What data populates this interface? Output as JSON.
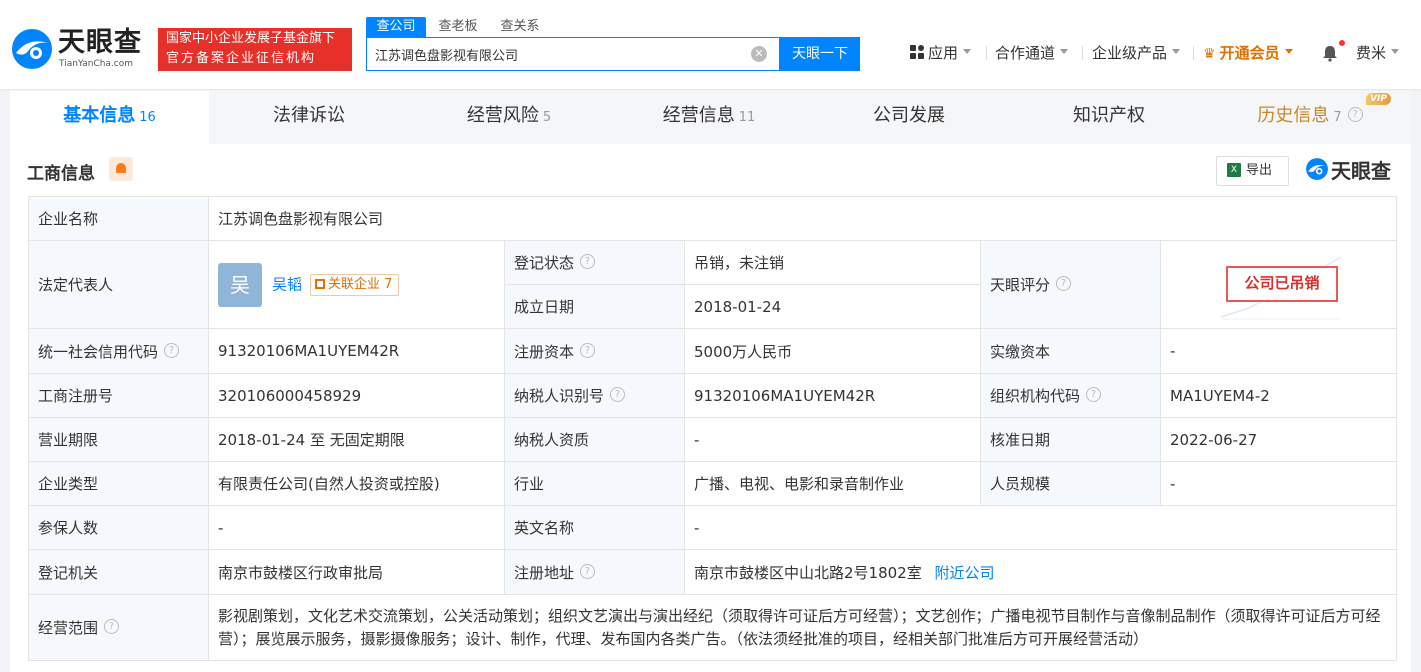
{
  "header": {
    "logo_text": "天眼查",
    "logo_sub": "TianYanCha.com",
    "badge_line1": "国家中小企业发展子基金旗下",
    "badge_line2": "官方备案企业征信机构",
    "search_tabs": [
      "查公司",
      "查老板",
      "查关系"
    ],
    "search_value": "江苏调色盘影视有限公司",
    "search_button": "天眼一下",
    "nav": {
      "apps": "应用",
      "channel": "合作通道",
      "enterprise": "企业级产品",
      "vip": "开通会员",
      "user": "费米"
    }
  },
  "tabs": [
    {
      "label": "基本信息",
      "count": "16"
    },
    {
      "label": "法律诉讼",
      "count": ""
    },
    {
      "label": "经营风险",
      "count": "5"
    },
    {
      "label": "经营信息",
      "count": "11"
    },
    {
      "label": "公司发展",
      "count": ""
    },
    {
      "label": "知识产权",
      "count": ""
    },
    {
      "label": "历史信息",
      "count": "7"
    }
  ],
  "vip_tag": "VIP",
  "section": {
    "title": "工商信息",
    "export_label": "导出",
    "watermark": "天眼查"
  },
  "info": {
    "company_name_label": "企业名称",
    "company_name": "江苏调色盘影视有限公司",
    "legal_rep_label": "法定代表人",
    "legal_rep_avatar": "吴",
    "legal_rep_name": "吴韬",
    "related_label": "关联企业",
    "related_count": "7",
    "reg_status_label": "登记状态",
    "reg_status": "吊销，未注销",
    "found_date_label": "成立日期",
    "found_date": "2018-01-24",
    "score_label": "天眼评分",
    "score_stamp": "公司已吊销",
    "credit_code_label": "统一社会信用代码",
    "credit_code": "91320106MA1UYEM42R",
    "reg_capital_label": "注册资本",
    "reg_capital": "5000万人民币",
    "paid_capital_label": "实缴资本",
    "paid_capital": "-",
    "reg_no_label": "工商注册号",
    "reg_no": "320106000458929",
    "taxpayer_id_label": "纳税人识别号",
    "taxpayer_id": "91320106MA1UYEM42R",
    "org_code_label": "组织机构代码",
    "org_code": "MA1UYEM4-2",
    "term_label": "营业期限",
    "term": "2018-01-24 至 无固定期限",
    "taxpayer_qual_label": "纳税人资质",
    "taxpayer_qual": "-",
    "approve_date_label": "核准日期",
    "approve_date": "2022-06-27",
    "type_label": "企业类型",
    "type": "有限责任公司(自然人投资或控股)",
    "industry_label": "行业",
    "industry": "广播、电视、电影和录音制作业",
    "staff_label": "人员规模",
    "staff": "-",
    "insured_label": "参保人数",
    "insured": "-",
    "en_name_label": "英文名称",
    "en_name": "-",
    "authority_label": "登记机关",
    "authority": "南京市鼓楼区行政审批局",
    "address_label": "注册地址",
    "address": "南京市鼓楼区中山北路2号1802室",
    "nearby": "附近公司",
    "scope_label": "经营范围",
    "scope": "影视剧策划，文化艺术交流策划，公关活动策划；组织文艺演出与演出经纪（须取得许可证后方可经营）；文艺创作；广播电视节目制作与音像制品制作（须取得许可证后方可经营）；展览展示服务，摄影摄像服务；设计、制作，代理、发布国内各类广告。（依法须经批准的项目，经相关部门批准后方可开展经营活动）"
  },
  "colors": {
    "brand": "#0084ff",
    "badge_red": "#e5312a",
    "revoked_red": "#f04040",
    "vip_orange": "#e07000"
  }
}
